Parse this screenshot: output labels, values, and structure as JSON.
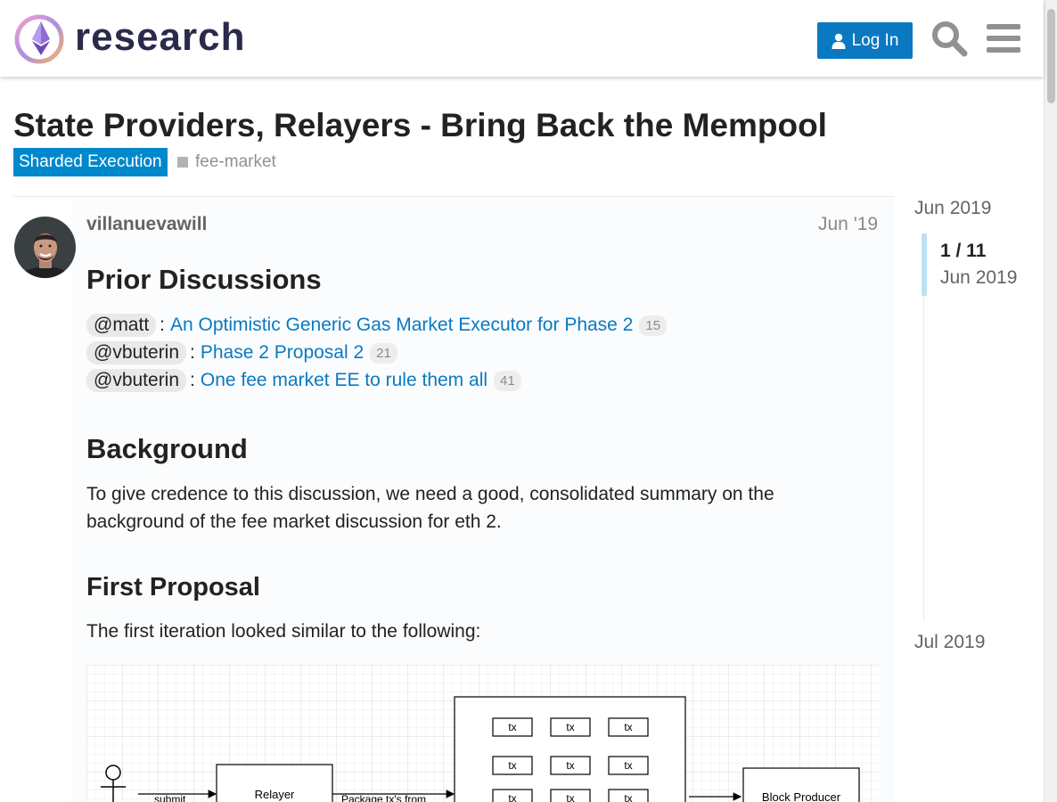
{
  "header": {
    "logo_text": "research",
    "login_label": "Log In"
  },
  "topic": {
    "title": "State Providers, Relayers - Bring Back the Mempool",
    "category": "Sharded Execution",
    "tag": "fee-market"
  },
  "post": {
    "username": "villanuevawill",
    "date": "Jun '19",
    "prior_heading": "Prior Discussions",
    "prior": [
      {
        "mention": "@matt",
        "title": "An Optimistic Generic Gas Market Executor for Phase 2",
        "count": "15"
      },
      {
        "mention": "@vbuterin",
        "title": "Phase 2 Proposal 2",
        "count": "21"
      },
      {
        "mention": "@vbuterin",
        "title": "One fee market EE to rule them all",
        "count": "41"
      }
    ],
    "background_heading": "Background",
    "background_text": "To give credence to this discussion, we need a good, consolidated summary on the background of the fee market discussion for eth 2.",
    "first_heading": "First Proposal",
    "first_text": "The first iteration looked similar to the following:",
    "diagram": {
      "submit": "submit",
      "relayer": "Relayer",
      "package": "Package tx's from",
      "tx": "tx",
      "block_producer": "Block Producer"
    }
  },
  "timeline": {
    "start": "Jun 2019",
    "position": "1 / 11",
    "current_date": "Jun 2019",
    "end": "Jul 2019"
  },
  "colors": {
    "accent": "#0a79c2",
    "category": "#0088cc"
  }
}
